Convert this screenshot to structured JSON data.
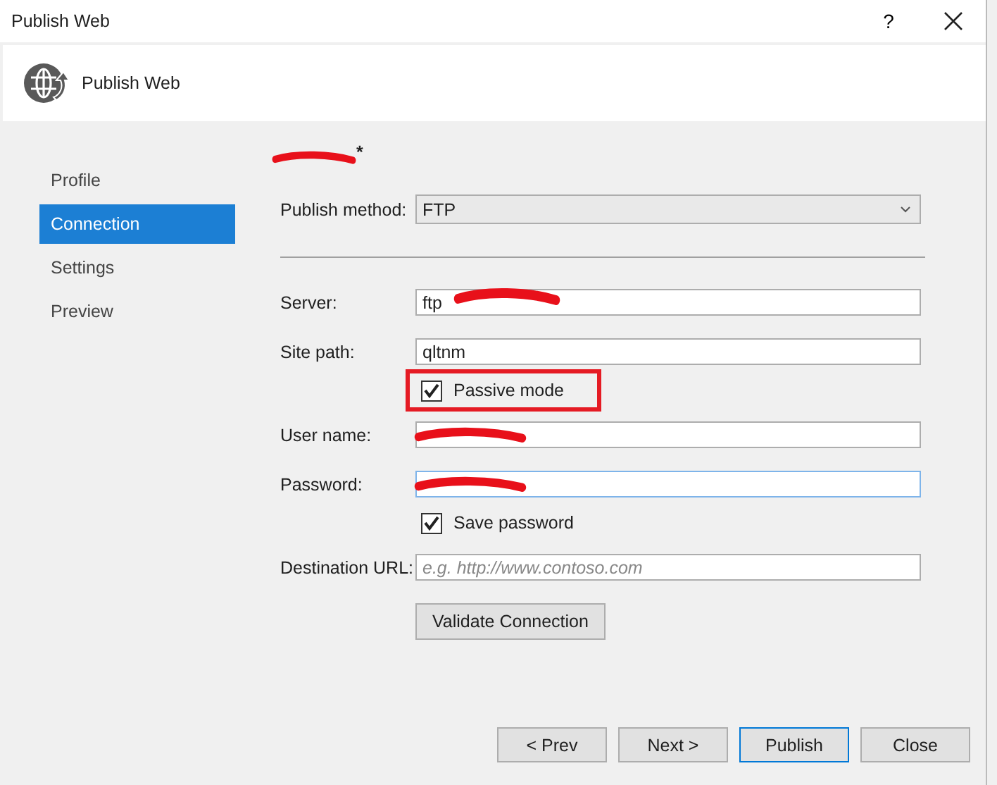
{
  "window": {
    "title": "Publish Web",
    "help": "?"
  },
  "header": {
    "title": "Publish Web"
  },
  "steps": [
    {
      "label": "Profile",
      "selected": false
    },
    {
      "label": "Connection",
      "selected": true
    },
    {
      "label": "Settings",
      "selected": false
    },
    {
      "label": "Preview",
      "selected": false
    }
  ],
  "profile": {
    "title": "*",
    "redacted": true
  },
  "form": [
    {
      "kind": "select",
      "label": "Publish method:",
      "value": "FTP"
    },
    {
      "kind": "divider"
    },
    {
      "kind": "text",
      "label": "Server:",
      "value": "ftp",
      "redacted": true
    },
    {
      "kind": "text",
      "label": "Site path:",
      "value": "qltnm"
    },
    {
      "kind": "checkbox",
      "label": "Passive mode",
      "checked": true,
      "highlighted": true
    },
    {
      "kind": "text",
      "label": "User name:",
      "redacted": true
    },
    {
      "kind": "text",
      "label": "Password:",
      "redacted": true,
      "focused": true
    },
    {
      "kind": "checkbox",
      "label": "Save password",
      "checked": true
    },
    {
      "kind": "text",
      "label": "Destination URL:",
      "placeholder": "e.g. http://www.contoso.com"
    },
    {
      "kind": "button",
      "label": "Validate Connection"
    }
  ],
  "buttons": [
    {
      "label": "< Prev",
      "default": false
    },
    {
      "label": "Next >",
      "default": false
    },
    {
      "label": "Publish",
      "default": true
    },
    {
      "label": "Close",
      "default": false
    }
  ]
}
